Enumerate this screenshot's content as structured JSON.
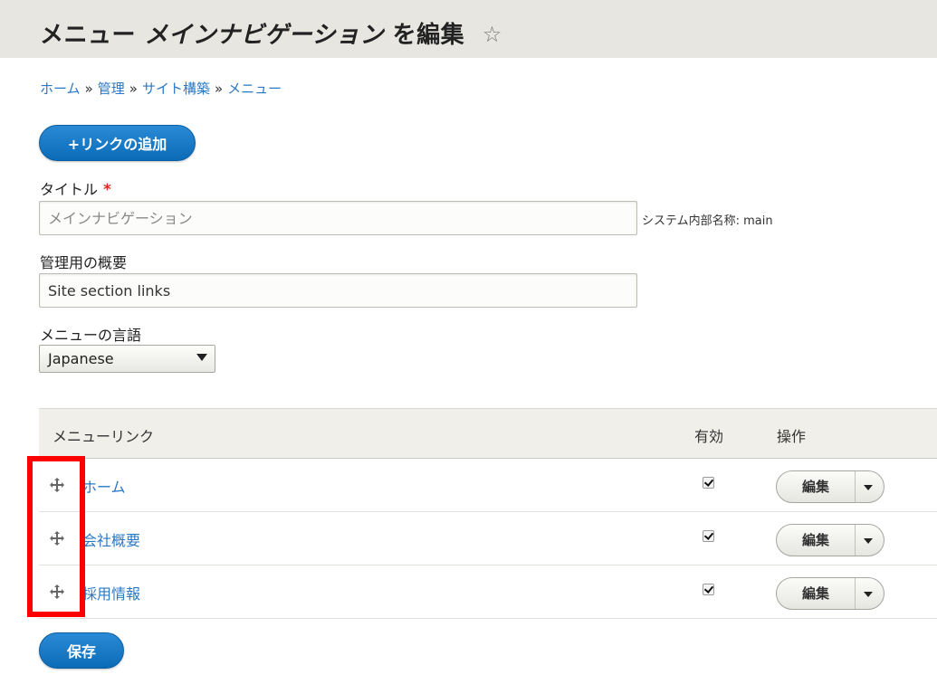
{
  "header": {
    "title_part1": "メニュー",
    "title_part2": "メインナビゲーション",
    "title_part3": "を編集",
    "star": "☆"
  },
  "breadcrumb": {
    "items": [
      "ホーム",
      "管理",
      "サイト構築",
      "メニュー"
    ],
    "separator": "»"
  },
  "add_link_button": "+リンクの追加",
  "title_field": {
    "label": "タイトル",
    "required_mark": "*",
    "placeholder": "メインナビゲーション",
    "machine_name": "システム内部名称: main"
  },
  "description_field": {
    "label": "管理用の概要",
    "value": "Site section links"
  },
  "language_field": {
    "label": "メニューの言語",
    "selected": "Japanese"
  },
  "table": {
    "columns": {
      "link": "メニューリンク",
      "enabled": "有効",
      "operations": "操作"
    },
    "rows": [
      {
        "label": "ホーム",
        "enabled": true,
        "operation": "編集"
      },
      {
        "label": "会社概要",
        "enabled": true,
        "operation": "編集"
      },
      {
        "label": "採用情報",
        "enabled": true,
        "operation": "編集"
      }
    ]
  },
  "save_button": "保存",
  "highlight_color": "#ff0000",
  "accent_color": "#0b6bb7",
  "link_color": "#2b78c5"
}
